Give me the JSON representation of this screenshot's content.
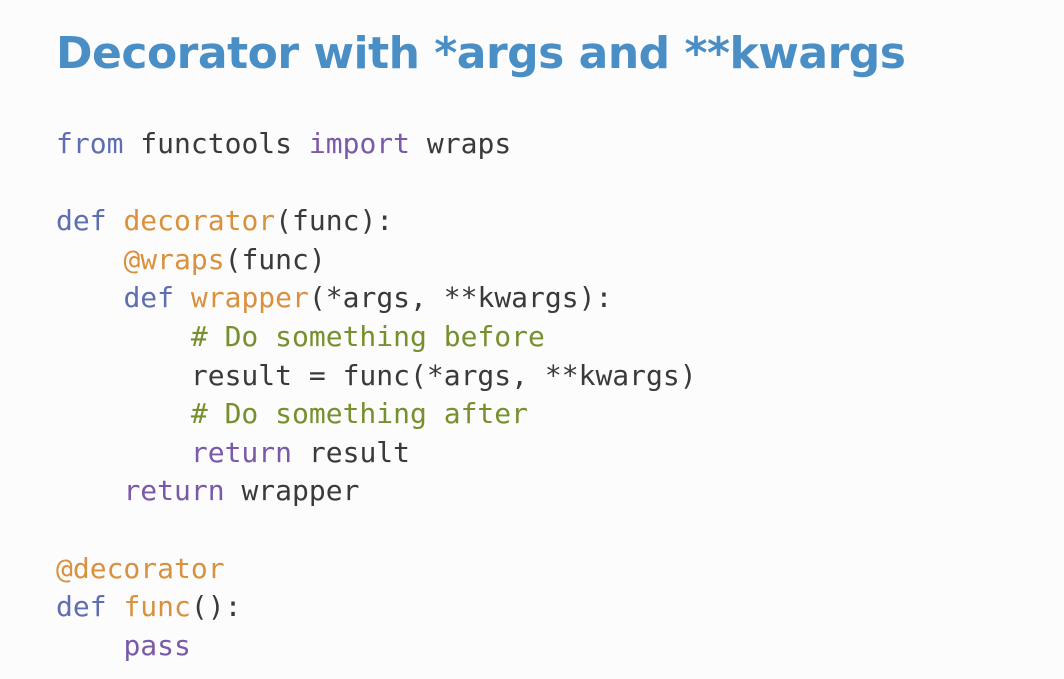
{
  "slide": {
    "title": "Decorator with *args and **kwargs"
  },
  "code": {
    "lines": [
      [
        {
          "t": "from",
          "c": "kw"
        },
        {
          "t": " functools ",
          "c": "txt"
        },
        {
          "t": "import",
          "c": "kw2"
        },
        {
          "t": " wraps",
          "c": "txt"
        }
      ],
      [],
      [
        {
          "t": "def",
          "c": "kw"
        },
        {
          "t": " ",
          "c": "txt"
        },
        {
          "t": "decorator",
          "c": "name"
        },
        {
          "t": "(func):",
          "c": "txt"
        }
      ],
      [
        {
          "t": "    ",
          "c": "txt"
        },
        {
          "t": "@wraps",
          "c": "name"
        },
        {
          "t": "(func)",
          "c": "txt"
        }
      ],
      [
        {
          "t": "    ",
          "c": "txt"
        },
        {
          "t": "def",
          "c": "kw"
        },
        {
          "t": " ",
          "c": "txt"
        },
        {
          "t": "wrapper",
          "c": "name"
        },
        {
          "t": "(*args, **kwargs):",
          "c": "txt"
        }
      ],
      [
        {
          "t": "        ",
          "c": "txt"
        },
        {
          "t": "# Do something before",
          "c": "cmt"
        }
      ],
      [
        {
          "t": "        result = func(*args, **kwargs)",
          "c": "txt"
        }
      ],
      [
        {
          "t": "        ",
          "c": "txt"
        },
        {
          "t": "# Do something after",
          "c": "cmt"
        }
      ],
      [
        {
          "t": "        ",
          "c": "txt"
        },
        {
          "t": "return",
          "c": "kw2"
        },
        {
          "t": " result",
          "c": "txt"
        }
      ],
      [
        {
          "t": "    ",
          "c": "txt"
        },
        {
          "t": "return",
          "c": "kw2"
        },
        {
          "t": " wrapper",
          "c": "txt"
        }
      ],
      [],
      [
        {
          "t": "@decorator",
          "c": "name"
        }
      ],
      [
        {
          "t": "def",
          "c": "kw"
        },
        {
          "t": " ",
          "c": "txt"
        },
        {
          "t": "func",
          "c": "name"
        },
        {
          "t": "():",
          "c": "txt"
        }
      ],
      [
        {
          "t": "    ",
          "c": "txt"
        },
        {
          "t": "pass",
          "c": "kw2"
        }
      ]
    ]
  },
  "colors": {
    "title": "#4a8ec6",
    "keyword_def_from": "#5f6eb0",
    "keyword_import_return_pass": "#7a59a8",
    "function_names_decorators": "#d9913e",
    "comments": "#77902e",
    "plain_text": "#3a3a3a",
    "background": "#fcfcfc"
  }
}
